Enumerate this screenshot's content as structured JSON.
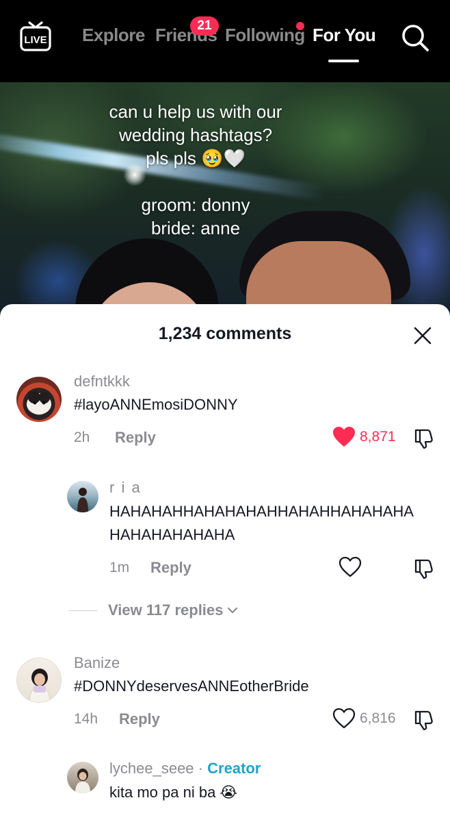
{
  "nav": {
    "live_label": "LIVE",
    "tabs": [
      {
        "label": "Explore"
      },
      {
        "label": "Friends",
        "badge": "21"
      },
      {
        "label": "Following"
      },
      {
        "label": "For You"
      }
    ],
    "active_tab": "For You"
  },
  "video": {
    "caption_lines": [
      "can u help us with our",
      "wedding hashtags?",
      "pls pls 🥹🤍",
      "groom: donny",
      "bride: anne"
    ]
  },
  "comments_sheet": {
    "title": "1,234 comments",
    "comments": [
      {
        "username": "defntkkk",
        "text": "#layoANNEmosiDONNY",
        "time": "2h",
        "reply_label": "Reply",
        "likes": "8,871",
        "liked": true
      },
      {
        "username": "r i a",
        "text": "HAHAHAHHAHAHAHAHHAHAHHAHAHAHA HAHAHAHAHAHA",
        "text_lines": [
          "HAHAHAHHAHAHAHAHHAHAHHAHAHAHA",
          "HAHAHAHAHAHA"
        ],
        "time": "1m",
        "reply_label": "Reply",
        "likes": "",
        "liked": false
      },
      {
        "username": "Banize",
        "text": "#DONNYdeservesANNEotherBride",
        "time": "14h",
        "reply_label": "Reply",
        "likes": "6,816",
        "liked": false
      },
      {
        "username": "lychee_seee",
        "creator_sep": "·",
        "creator_label": "Creator",
        "text": "kita mo pa ni ba 😭"
      }
    ],
    "view_replies_label": "View 117 replies"
  },
  "colors": {
    "accent": "#fe2c55",
    "creator": "#20a3c7",
    "muted": "#8a8b91",
    "text": "#161823"
  },
  "icons": [
    "live-icon",
    "search-icon",
    "close-icon",
    "heart-filled-icon",
    "heart-outline-icon",
    "dislike-icon",
    "chevron-down-icon"
  ]
}
